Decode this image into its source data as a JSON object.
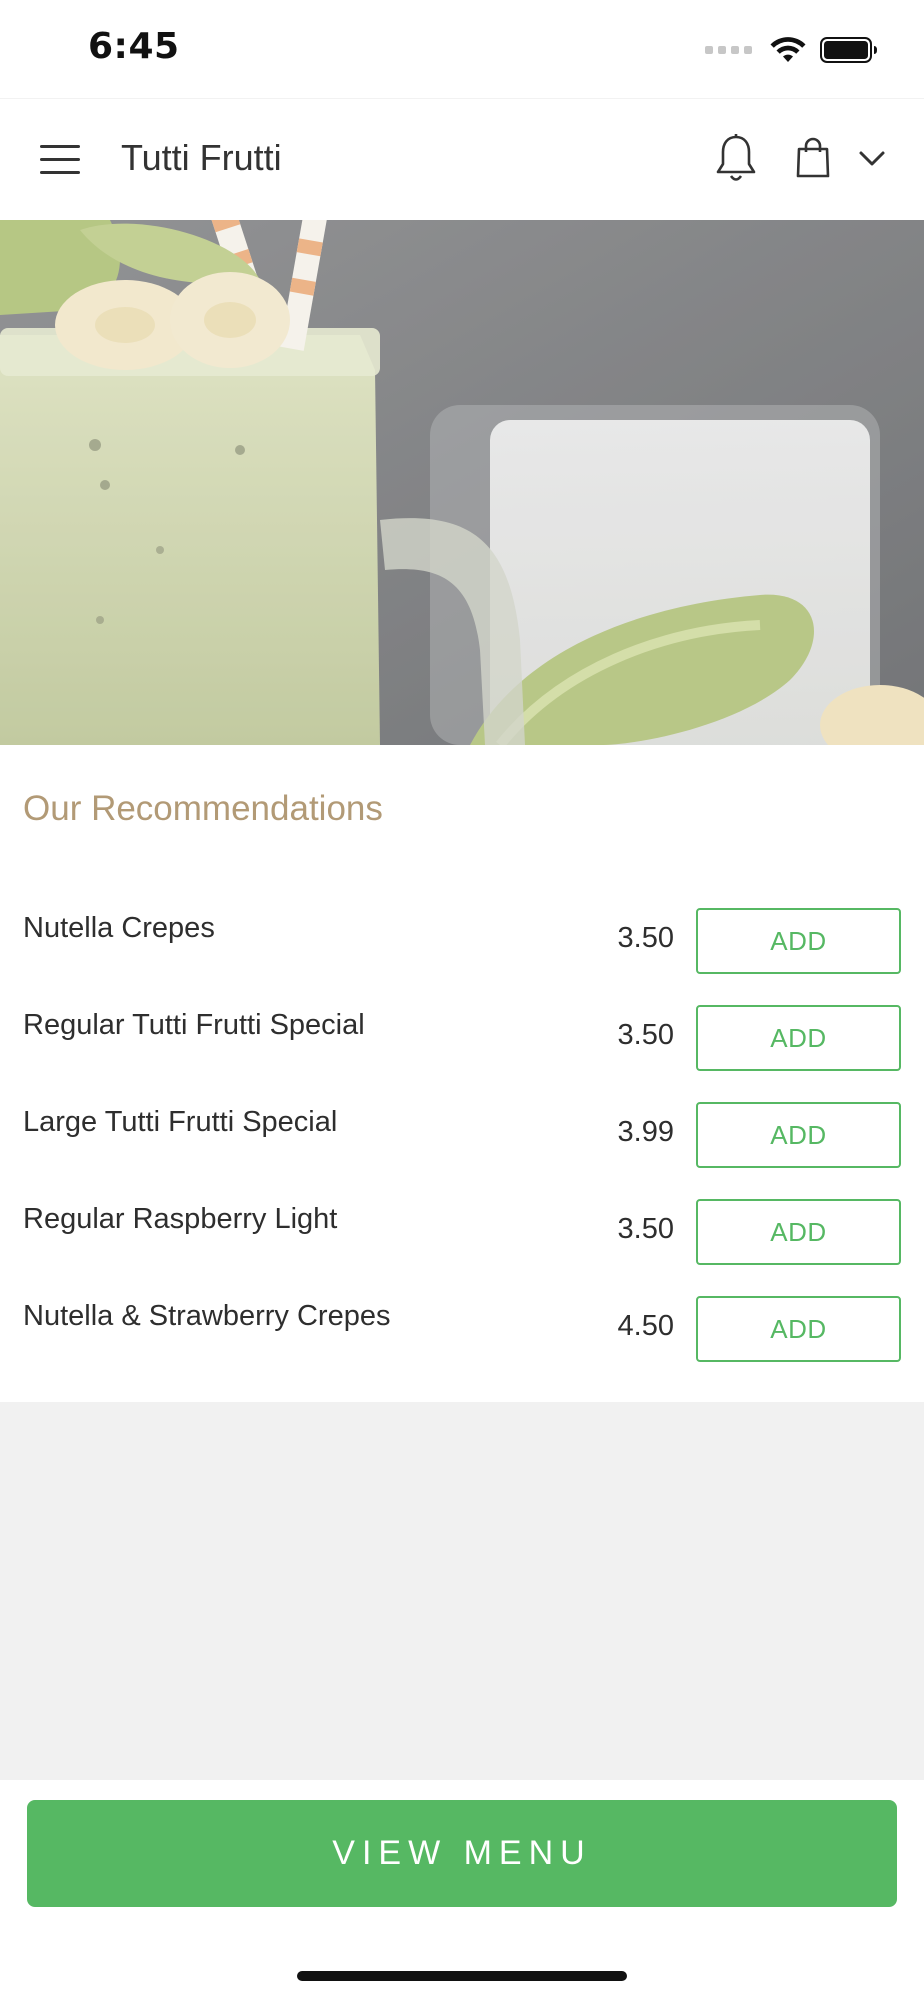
{
  "status_bar": {
    "time": "6:45",
    "icons": [
      "signal-icon",
      "wifi-icon",
      "battery-icon"
    ]
  },
  "header": {
    "title": "Tutti Frutti",
    "icons": [
      "menu-icon",
      "bell-icon",
      "shopping-bag-icon",
      "chevron-down-icon"
    ]
  },
  "hero": {
    "image": "green smoothie in mason jar with banana slices, avocado and striped straws"
  },
  "recommendations": {
    "title": "Our Recommendations",
    "items": [
      {
        "name": "Nutella Crepes",
        "price": "3.50",
        "button": "ADD"
      },
      {
        "name": "Regular Tutti Frutti Special",
        "price": "3.50",
        "button": "ADD"
      },
      {
        "name": "Large Tutti Frutti Special",
        "price": "3.99",
        "button": "ADD"
      },
      {
        "name": "Regular Raspberry Light",
        "price": "3.50",
        "button": "ADD"
      },
      {
        "name": "Nutella & Strawberry Crepes",
        "price": "4.50",
        "button": "ADD"
      }
    ]
  },
  "footer": {
    "view_menu_label": "VIEW MENU"
  },
  "colors": {
    "accent_green": "#56b863",
    "section_title": "#b29a76",
    "gray_background": "#f1f1f1"
  }
}
